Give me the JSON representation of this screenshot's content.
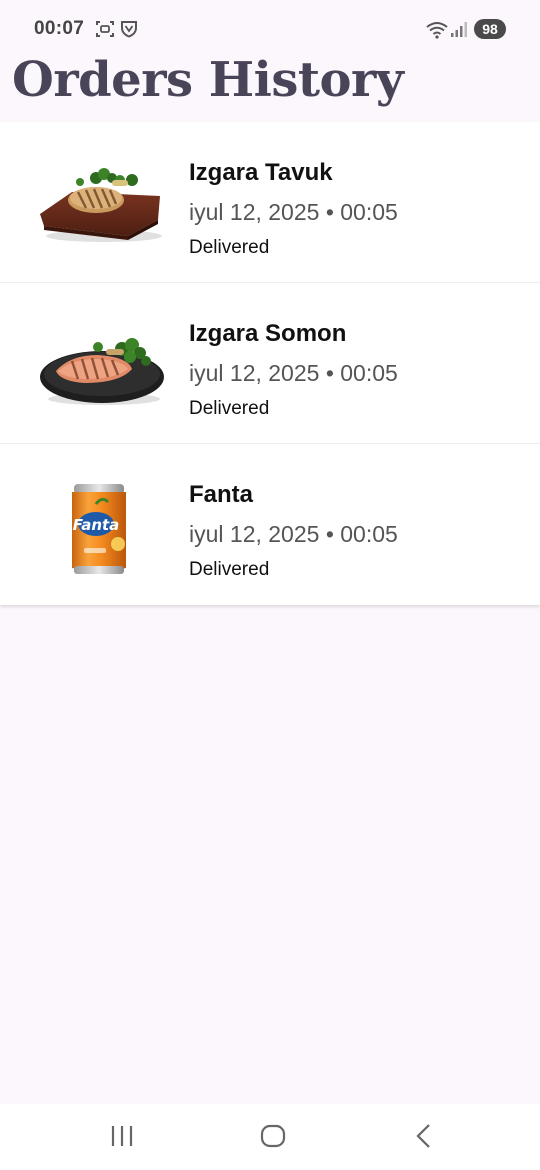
{
  "status_bar": {
    "time": "00:07",
    "battery": "98",
    "icons": [
      "screenshot-icon",
      "vpn-shield-icon",
      "wifi-icon",
      "signal-icon"
    ]
  },
  "header": {
    "title": "Orders History"
  },
  "orders": [
    {
      "name": "Izgara Tavuk",
      "date": "iyul 12, 2025 • 00:05",
      "status": "Delivered",
      "image": "grilled-chicken-image"
    },
    {
      "name": "Izgara Somon",
      "date": "iyul 12, 2025 • 00:05",
      "status": "Delivered",
      "image": "grilled-salmon-image"
    },
    {
      "name": "Fanta",
      "date": "iyul 12, 2025 • 00:05",
      "status": "Delivered",
      "image": "fanta-can-image"
    }
  ],
  "nav_bar": {
    "buttons": [
      "recents-icon",
      "home-icon",
      "back-icon"
    ]
  },
  "colors": {
    "background": "#FCF7FC",
    "title": "#4a4458",
    "card": "#ffffff",
    "fanta_orange": "#F58A1F"
  }
}
